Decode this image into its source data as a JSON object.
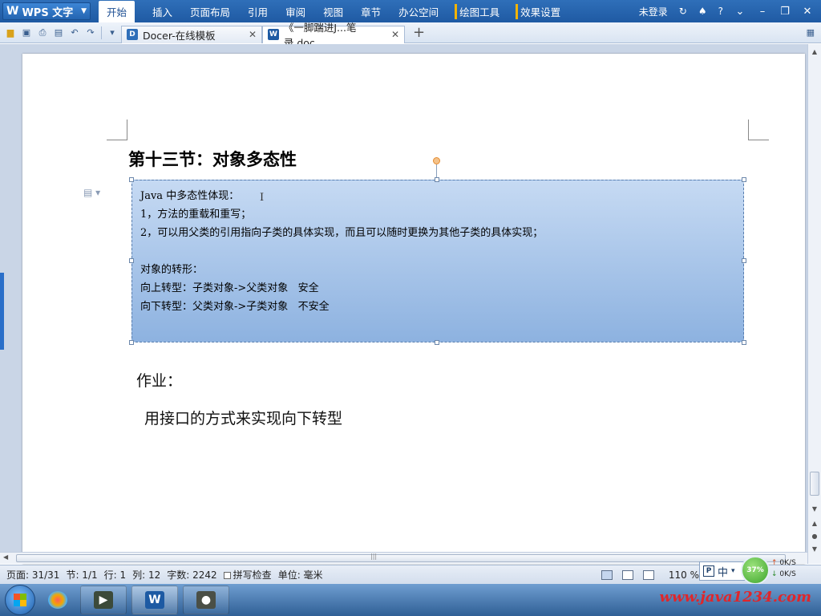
{
  "menubar": {
    "app_name": "WPS 文字",
    "items": [
      "开始",
      "插入",
      "页面布局",
      "引用",
      "审阅",
      "视图",
      "章节",
      "办公空间"
    ],
    "tools": [
      "绘图工具",
      "效果设置"
    ],
    "login": "未登录",
    "help": "?"
  },
  "tabs": [
    {
      "label": "Docer-在线模板",
      "icon_text": "D"
    },
    {
      "label": "《一脚踹进J...笔录.doc",
      "icon_text": "W"
    }
  ],
  "document": {
    "heading": "第十三节：对象多态性",
    "textbox_lines": [
      "Java 中多态性体现：",
      "1，方法的重载和重写；",
      "2，可以用父类的引用指向子类的具体实现，而且可以随时更换为其他子类的具体实现；",
      "",
      "对象的转形：",
      "向上转型：子类对象->父类对象   安全",
      "向下转型：父类对象->子类对象   不安全"
    ],
    "homework_label": "作业：",
    "homework_task": "用接口的方式来实现向下转型"
  },
  "statusbar": {
    "page": "页面: 31/31",
    "section": "节: 1/1",
    "row": "行: 1",
    "col": "列: 12",
    "word_count": "字数: 2242",
    "spell_check": "拼写检查",
    "unit": "单位: 毫米",
    "zoom": "110 %",
    "zoom_minus": "—"
  },
  "tray": {
    "ime_label": "中",
    "ime_logo": "P",
    "net_percent": "37%",
    "up_speed": "0K/S",
    "down_speed": "0K/S",
    "watermark": "www.java1234.com"
  }
}
